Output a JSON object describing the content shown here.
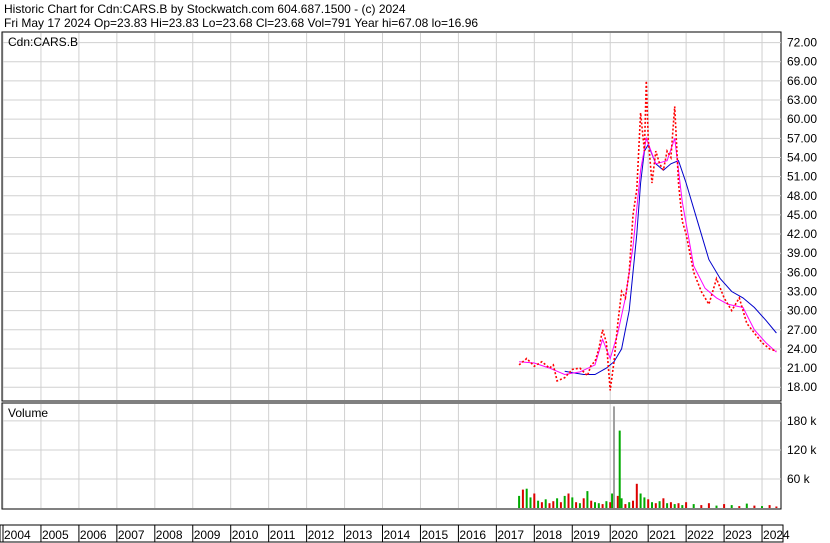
{
  "header": {
    "line1": "Historic Chart for Cdn:CARS.B by Stockwatch.com 604.687.1500 - (c) 2024",
    "line2": "Fri May 17 2024   Op=23.83  Hi=23.83  Lo=23.68  Cl=23.68  Vol=791  Year hi=67.08  lo=16.96"
  },
  "colors": {
    "price": "#ff0000",
    "ma_short": "#ff00ff",
    "ma_long": "#0000cc",
    "grid": "#d0d0d0",
    "volume_up": "#00aa00",
    "volume_down": "#dd0000",
    "volume_neutral": "#a0a0a0"
  },
  "chart_data": [
    {
      "type": "line",
      "label": "Cdn:CARS.B",
      "xlim": [
        2004,
        2024.5
      ],
      "ylim": [
        16.0,
        73.5
      ],
      "yticks": [
        18,
        21,
        24,
        27,
        30,
        33,
        36,
        39,
        42,
        45,
        48,
        51,
        54,
        57,
        60,
        63,
        66,
        69,
        72
      ],
      "ytick_labels": [
        "18.00",
        "21.00",
        "24.00",
        "27.00",
        "30.00",
        "33.00",
        "36.00",
        "39.00",
        "42.00",
        "45.00",
        "48.00",
        "51.00",
        "54.00",
        "57.00",
        "60.00",
        "63.00",
        "66.00",
        "69.00",
        "72.00"
      ],
      "grid": true,
      "series": [
        {
          "role": "price",
          "x": [
            2017.6,
            2017.8,
            2018.0,
            2018.2,
            2018.4,
            2018.5,
            2018.6,
            2018.8,
            2019.0,
            2019.2,
            2019.4,
            2019.5,
            2019.6,
            2019.7,
            2019.8,
            2019.9,
            2020.0,
            2020.1,
            2020.2,
            2020.3,
            2020.4,
            2020.5,
            2020.6,
            2020.7,
            2020.8,
            2020.9,
            2020.95,
            2021.0,
            2021.1,
            2021.2,
            2021.3,
            2021.4,
            2021.5,
            2021.6,
            2021.7,
            2021.8,
            2021.9,
            2022.0,
            2022.2,
            2022.4,
            2022.6,
            2022.8,
            2023.0,
            2023.2,
            2023.4,
            2023.6,
            2023.8,
            2024.0,
            2024.2,
            2024.38
          ],
          "values": [
            21.5,
            22.5,
            21.3,
            22.0,
            21.0,
            21.5,
            19.0,
            19.5,
            20.8,
            21.0,
            19.8,
            21.5,
            22.0,
            24.0,
            27.0,
            25.0,
            17.5,
            22.0,
            28.0,
            33.0,
            32.0,
            36.0,
            45.0,
            49.0,
            61.0,
            55.0,
            66.0,
            57.0,
            50.0,
            55.0,
            53.0,
            52.0,
            55.0,
            54.0,
            62.0,
            50.0,
            44.0,
            42.0,
            36.0,
            33.0,
            31.0,
            35.0,
            32.0,
            30.0,
            32.0,
            28.0,
            26.5,
            25.0,
            24.0,
            23.68
          ]
        },
        {
          "role": "moving_average_short",
          "x": [
            2017.6,
            2018.0,
            2018.4,
            2018.8,
            2019.2,
            2019.6,
            2019.8,
            2020.0,
            2020.2,
            2020.4,
            2020.6,
            2020.8,
            2020.95,
            2021.2,
            2021.5,
            2021.7,
            2021.9,
            2022.2,
            2022.5,
            2022.8,
            2023.1,
            2023.5,
            2023.8,
            2024.1,
            2024.38
          ],
          "values": [
            22.0,
            21.8,
            21.0,
            20.0,
            20.4,
            21.5,
            25.5,
            22.5,
            26.5,
            32.0,
            40.0,
            52.0,
            57.0,
            53.0,
            53.5,
            57.0,
            47.0,
            37.0,
            33.5,
            32.0,
            31.0,
            30.5,
            27.0,
            25.0,
            23.5
          ]
        },
        {
          "role": "moving_average_long",
          "x": [
            2018.8,
            2019.0,
            2019.3,
            2019.6,
            2019.9,
            2020.1,
            2020.3,
            2020.5,
            2020.7,
            2020.8,
            2020.9,
            2021.0,
            2021.2,
            2021.4,
            2021.6,
            2021.8,
            2022.0,
            2022.3,
            2022.6,
            2022.9,
            2023.2,
            2023.5,
            2023.8,
            2024.1,
            2024.38
          ],
          "values": [
            20.5,
            20.3,
            20.0,
            20.0,
            21.0,
            22.0,
            24.0,
            30.0,
            42.0,
            50.0,
            55.0,
            56.0,
            53.0,
            52.0,
            53.0,
            53.5,
            50.0,
            44.0,
            38.0,
            35.0,
            33.0,
            32.0,
            30.5,
            28.5,
            26.5
          ]
        }
      ]
    },
    {
      "type": "bar",
      "label": "Volume",
      "xlim": [
        2004,
        2024.5
      ],
      "ylim": [
        0,
        215000
      ],
      "yticks": [
        60000,
        120000,
        180000
      ],
      "ytick_labels": [
        "60 k",
        "120 k",
        "180 k"
      ],
      "grid": true,
      "x": [
        2017.6,
        2017.7,
        2017.8,
        2017.9,
        2018.0,
        2018.1,
        2018.2,
        2018.3,
        2018.4,
        2018.5,
        2018.6,
        2018.7,
        2018.8,
        2018.9,
        2019.0,
        2019.1,
        2019.2,
        2019.3,
        2019.4,
        2019.5,
        2019.6,
        2019.7,
        2019.8,
        2019.9,
        2020.0,
        2020.05,
        2020.1,
        2020.2,
        2020.25,
        2020.3,
        2020.4,
        2020.5,
        2020.6,
        2020.7,
        2020.8,
        2020.9,
        2021.0,
        2021.1,
        2021.2,
        2021.3,
        2021.4,
        2021.5,
        2021.6,
        2021.7,
        2021.8,
        2021.9,
        2022.0,
        2022.2,
        2022.4,
        2022.6,
        2022.8,
        2023.0,
        2023.2,
        2023.4,
        2023.6,
        2023.8,
        2024.0,
        2024.2,
        2024.38
      ],
      "values": [
        25000,
        38000,
        40000,
        22000,
        30000,
        15000,
        12000,
        18000,
        10000,
        14000,
        20000,
        12000,
        25000,
        30000,
        22000,
        12000,
        10000,
        20000,
        35000,
        15000,
        12000,
        10000,
        8000,
        14000,
        12000,
        30000,
        210000,
        25000,
        160000,
        20000,
        8000,
        12000,
        15000,
        50000,
        30000,
        22000,
        18000,
        12000,
        10000,
        14000,
        20000,
        10000,
        12000,
        8000,
        10000,
        6000,
        12000,
        8000,
        6000,
        10000,
        5000,
        8000,
        6000,
        4000,
        9000,
        5000,
        4000,
        6000,
        3000
      ],
      "colors": [
        "up",
        "down",
        "up",
        "up",
        "down",
        "up",
        "down",
        "up",
        "down",
        "down",
        "up",
        "down",
        "up",
        "down",
        "up",
        "down",
        "up",
        "down",
        "up",
        "down",
        "up",
        "up",
        "down",
        "up",
        "down",
        "up",
        "neutral",
        "down",
        "up",
        "up",
        "down",
        "up",
        "down",
        "down",
        "up",
        "up",
        "down",
        "up",
        "down",
        "up",
        "down",
        "up",
        "down",
        "up",
        "down",
        "up",
        "down",
        "up",
        "down",
        "down",
        "up",
        "down",
        "up",
        "down",
        "up",
        "down",
        "up",
        "down",
        "down"
      ]
    }
  ],
  "x_axis": {
    "year_labels": [
      "2004",
      "2005",
      "2006",
      "2007",
      "2008",
      "2009",
      "2010",
      "2011",
      "2012",
      "2013",
      "2014",
      "2015",
      "2016",
      "2017",
      "2018",
      "2019",
      "2020",
      "2021",
      "2022",
      "2023",
      "2024"
    ]
  }
}
